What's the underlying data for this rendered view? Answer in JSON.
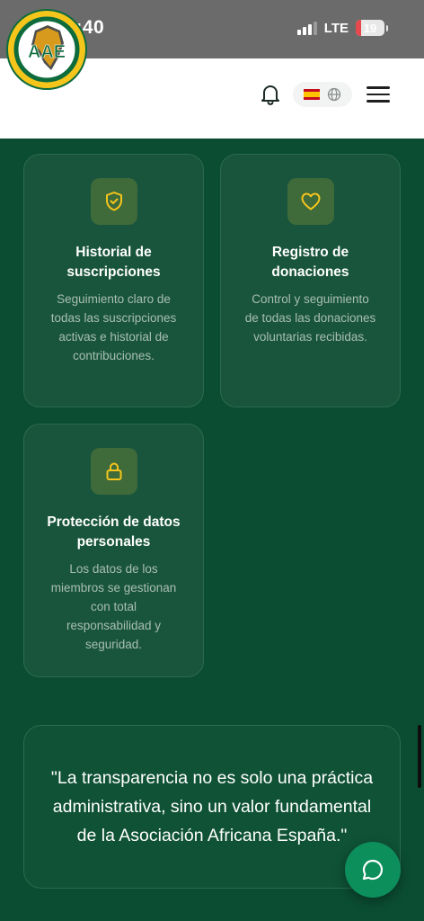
{
  "status_bar": {
    "time": "13:40",
    "network": "LTE",
    "battery": "19",
    "battery_level": 0.19
  },
  "header": {
    "logo_text": "AAE",
    "logo_arc_text": "ASOCIACIÓN AFRICANA EN ESPAÑA",
    "language_flag": "es-flag-icon",
    "icons": [
      "bell-icon",
      "globe-icon",
      "menu-icon"
    ]
  },
  "features": [
    {
      "icon": "shield-check-icon",
      "title": "Historial de suscripciones",
      "description": "Seguimiento claro de todas las suscripciones activas e historial de contribuciones."
    },
    {
      "icon": "heart-icon",
      "title": "Registro de donaciones",
      "description": "Control y seguimiento de todas las donaciones voluntarias recibidas."
    },
    {
      "icon": "lock-icon",
      "title": "Protección de datos personales",
      "description": "Los datos de los miembros se gestionan con total responsabilidad y seguridad."
    }
  ],
  "quote": {
    "text": "\"La transparencia no es solo una práctica administrativa, sino un valor fundamental de la Asociación Africana España.\""
  },
  "colors": {
    "page_background": "#0b4d33",
    "card_background": "#19553c",
    "accent_yellow": "#f5c51b",
    "chat_button": "#0d8f5c"
  }
}
